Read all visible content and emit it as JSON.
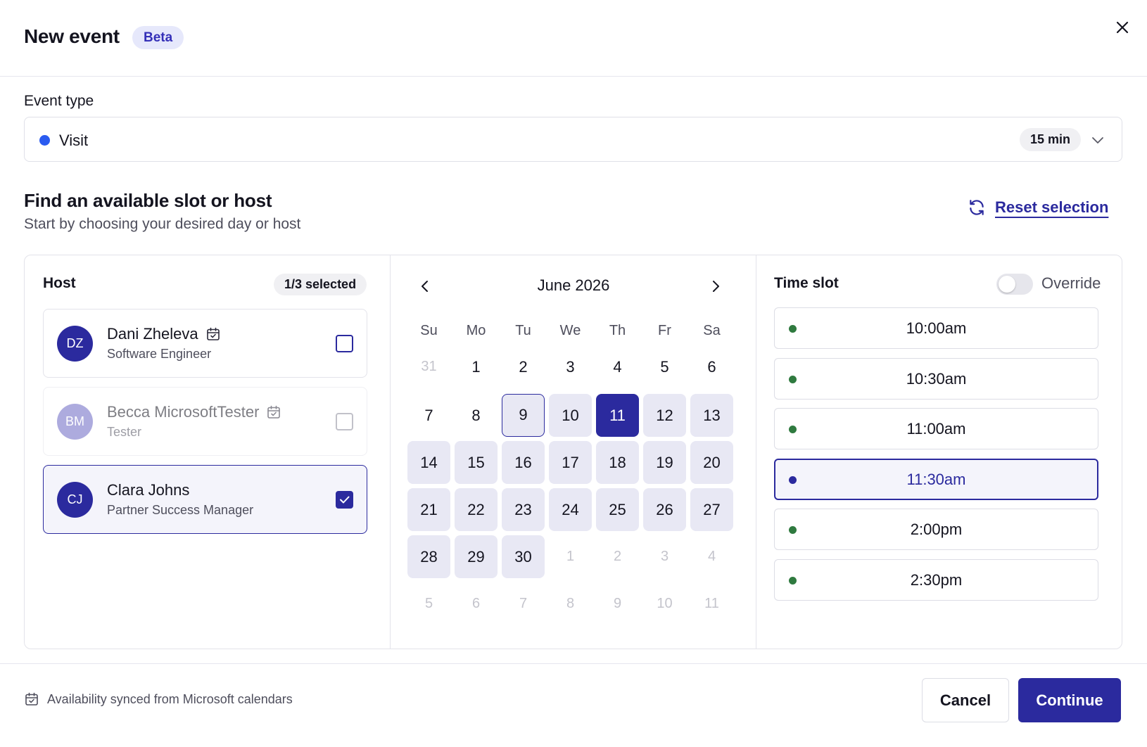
{
  "header": {
    "title": "New event",
    "badge": "Beta",
    "close_icon": "close-icon"
  },
  "event_type": {
    "label": "Event type",
    "value": "Visit",
    "color": "#2a5bf0",
    "duration": "15 min"
  },
  "find": {
    "title": "Find an available slot or host",
    "subtitle": "Start by choosing your desired day or host",
    "reset_label": "Reset selection"
  },
  "host": {
    "title": "Host",
    "count": "1/3 selected",
    "items": [
      {
        "initials": "DZ",
        "name": "Dani Zheleva",
        "role": "Software Engineer",
        "checked": false,
        "disabled": false
      },
      {
        "initials": "BM",
        "name": "Becca MicrosoftTester",
        "role": "Tester",
        "checked": false,
        "disabled": true
      },
      {
        "initials": "CJ",
        "name": "Clara Johns",
        "role": "Partner Success Manager",
        "checked": true,
        "disabled": false
      }
    ]
  },
  "calendar": {
    "month": "June 2026",
    "weekdays": [
      "Su",
      "Mo",
      "Tu",
      "We",
      "Th",
      "Fr",
      "Sa"
    ],
    "weeks": [
      [
        {
          "d": "31",
          "s": "muted"
        },
        {
          "d": "1",
          "s": "plain"
        },
        {
          "d": "2",
          "s": "plain"
        },
        {
          "d": "3",
          "s": "plain"
        },
        {
          "d": "4",
          "s": "plain"
        },
        {
          "d": "5",
          "s": "plain"
        },
        {
          "d": "6",
          "s": "plain"
        }
      ],
      [
        {
          "d": "7",
          "s": "plain"
        },
        {
          "d": "8",
          "s": "plain"
        },
        {
          "d": "9",
          "s": "today"
        },
        {
          "d": "10",
          "s": "avail"
        },
        {
          "d": "11",
          "s": "sel"
        },
        {
          "d": "12",
          "s": "avail"
        },
        {
          "d": "13",
          "s": "avail"
        }
      ],
      [
        {
          "d": "14",
          "s": "avail"
        },
        {
          "d": "15",
          "s": "avail"
        },
        {
          "d": "16",
          "s": "avail"
        },
        {
          "d": "17",
          "s": "avail"
        },
        {
          "d": "18",
          "s": "avail"
        },
        {
          "d": "19",
          "s": "avail"
        },
        {
          "d": "20",
          "s": "avail"
        }
      ],
      [
        {
          "d": "21",
          "s": "avail"
        },
        {
          "d": "22",
          "s": "avail"
        },
        {
          "d": "23",
          "s": "avail"
        },
        {
          "d": "24",
          "s": "avail"
        },
        {
          "d": "25",
          "s": "avail"
        },
        {
          "d": "26",
          "s": "avail"
        },
        {
          "d": "27",
          "s": "avail"
        }
      ],
      [
        {
          "d": "28",
          "s": "avail"
        },
        {
          "d": "29",
          "s": "avail"
        },
        {
          "d": "30",
          "s": "avail"
        },
        {
          "d": "1",
          "s": "muted"
        },
        {
          "d": "2",
          "s": "muted"
        },
        {
          "d": "3",
          "s": "muted"
        },
        {
          "d": "4",
          "s": "muted"
        }
      ],
      [
        {
          "d": "5",
          "s": "muted"
        },
        {
          "d": "6",
          "s": "muted"
        },
        {
          "d": "7",
          "s": "muted"
        },
        {
          "d": "8",
          "s": "muted"
        },
        {
          "d": "9",
          "s": "muted"
        },
        {
          "d": "10",
          "s": "muted"
        },
        {
          "d": "11",
          "s": "muted"
        }
      ]
    ]
  },
  "timeslot": {
    "title": "Time slot",
    "override_label": "Override",
    "override_on": false,
    "slots": [
      {
        "time": "10:00am",
        "selected": false
      },
      {
        "time": "10:30am",
        "selected": false
      },
      {
        "time": "11:00am",
        "selected": false
      },
      {
        "time": "11:30am",
        "selected": true
      },
      {
        "time": "2:00pm",
        "selected": false
      },
      {
        "time": "2:30pm",
        "selected": false
      }
    ]
  },
  "footer": {
    "sync_text": "Availability synced from Microsoft calendars",
    "cancel_label": "Cancel",
    "continue_label": "Continue"
  },
  "colors": {
    "accent": "#2b2a9e",
    "available_dot": "#2f7a3f",
    "badge_bg": "#e6e8fb"
  }
}
